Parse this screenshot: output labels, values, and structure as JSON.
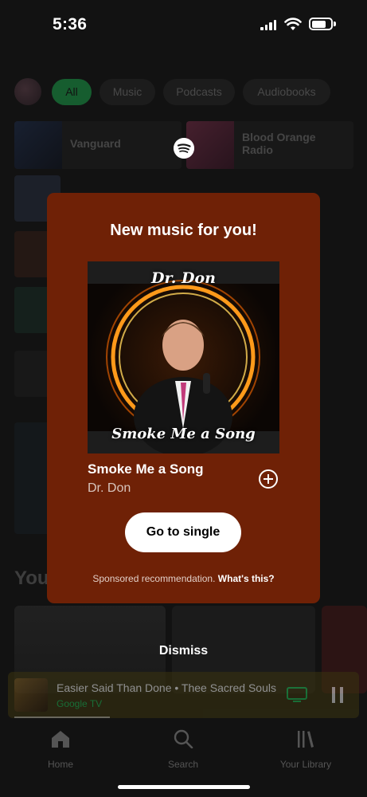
{
  "status_bar": {
    "time": "5:36"
  },
  "filters": [
    {
      "label": "All",
      "active": true
    },
    {
      "label": "Music",
      "active": false
    },
    {
      "label": "Podcasts",
      "active": false
    },
    {
      "label": "Audiobooks",
      "active": false
    }
  ],
  "background_tiles": {
    "left_top": "Vanguard",
    "right_top": "Blood Orange Radio",
    "section_heading": "You"
  },
  "modal": {
    "title": "New music for you!",
    "artwork_artist": "Dr. Don",
    "artwork_title": "Smoke Me a Song",
    "song_title": "Smoke Me a Song",
    "song_artist": "Dr. Don",
    "cta_label": "Go to single",
    "sponsored_text": "Sponsored recommendation.",
    "sponsored_link": "What's this?"
  },
  "dismiss_label": "Dismiss",
  "mini_player": {
    "track": "Easier Said Than Done • Thee Sacred Souls",
    "device": "Google TV"
  },
  "bottom_nav": [
    {
      "label": "Home",
      "icon": "home-icon"
    },
    {
      "label": "Search",
      "icon": "search-icon"
    },
    {
      "label": "Your Library",
      "icon": "library-icon"
    }
  ],
  "colors": {
    "modal_bg": "#6f2106",
    "spotify_green": "#1db954",
    "background": "#121212"
  }
}
